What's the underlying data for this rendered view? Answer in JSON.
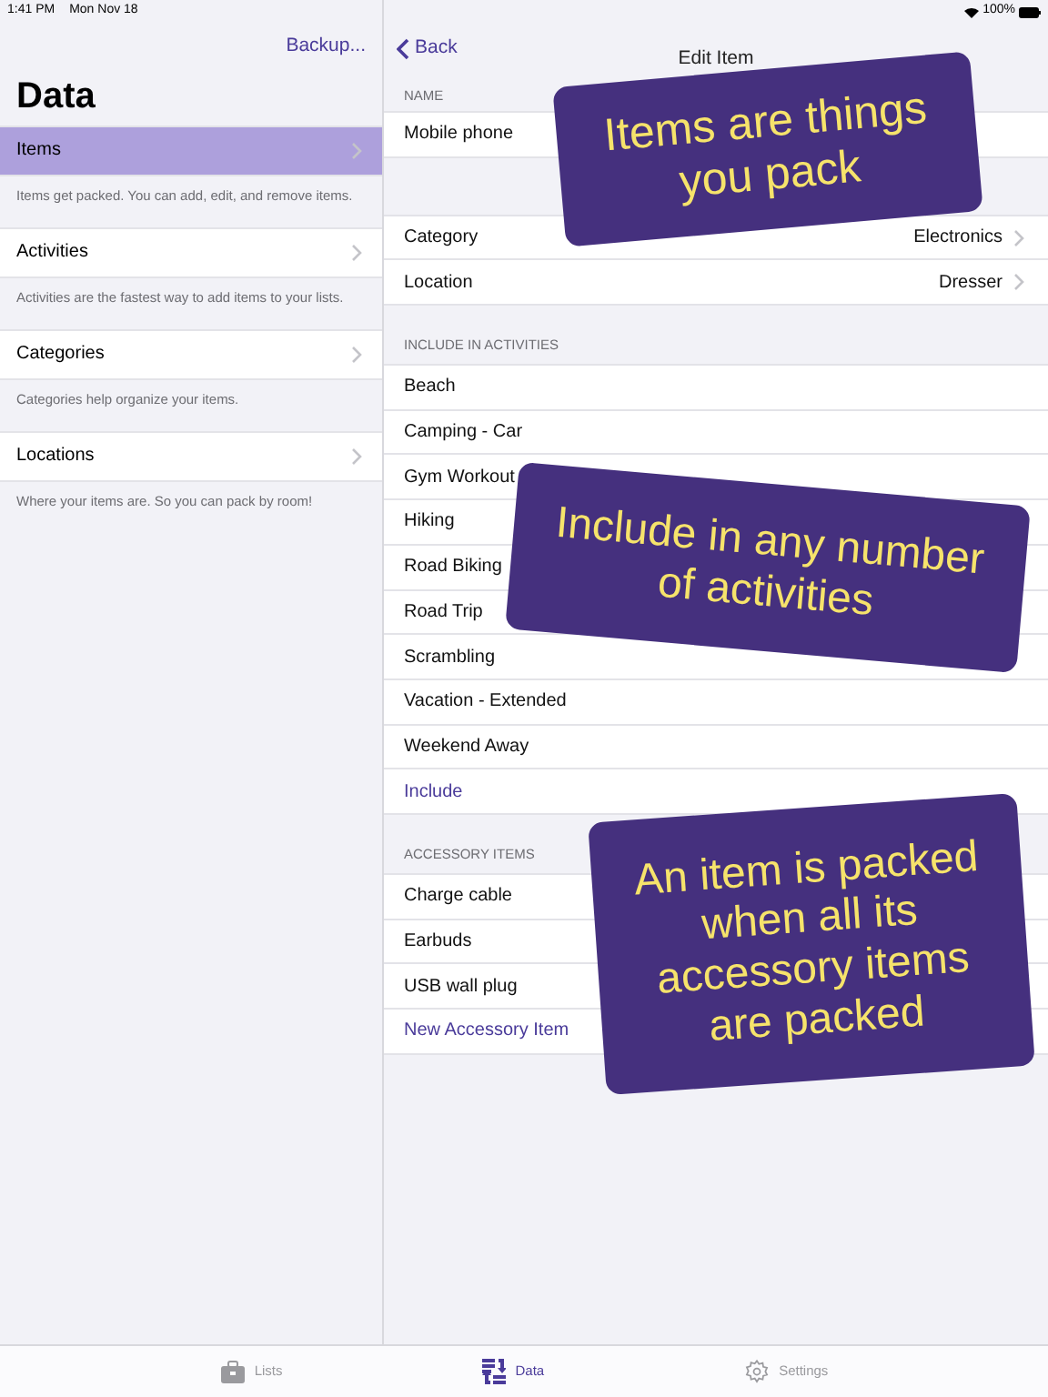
{
  "status_bar": {
    "time": "1:41 PM",
    "date": "Mon Nov 18",
    "battery": "100%"
  },
  "sidebar": {
    "action": "Backup...",
    "title": "Data",
    "items": [
      {
        "label": "Items",
        "footer": "Items get packed. You can add, edit, and remove items.",
        "selected": true
      },
      {
        "label": "Activities",
        "footer": "Activities are the fastest way to add items to your lists.",
        "selected": false
      },
      {
        "label": "Categories",
        "footer": "Categories help organize your items.",
        "selected": false
      },
      {
        "label": "Locations",
        "footer": "Where your items are. So you can pack by room!",
        "selected": false
      }
    ]
  },
  "detail": {
    "back": "Back",
    "title": "Edit Item",
    "name_header": "NAME",
    "name": "Mobile phone",
    "properties": [
      {
        "label": "Category",
        "value": "Electronics"
      },
      {
        "label": "Location",
        "value": "Dresser"
      }
    ],
    "activities_header": "INCLUDE IN ACTIVITIES",
    "activities": [
      "Beach",
      "Camping - Car",
      "Gym Workout",
      "Hiking",
      "Road Biking",
      "Road Trip",
      "Scrambling",
      "Vacation - Extended",
      "Weekend Away"
    ],
    "include_action": "Include",
    "accessories_header": "ACCESSORY ITEMS",
    "accessories": [
      "Charge cable",
      "Earbuds",
      "USB wall plug"
    ],
    "new_accessory_action": "New Accessory Item"
  },
  "callouts": [
    "Items are things you pack",
    "Include in any number of activities",
    "An item is packed when all its accessory items are packed"
  ],
  "tab_bar": [
    {
      "label": "Lists",
      "kind": "lists",
      "selected": false
    },
    {
      "label": "Data",
      "kind": "data",
      "selected": true
    },
    {
      "label": "Settings",
      "kind": "settings",
      "selected": false
    }
  ]
}
